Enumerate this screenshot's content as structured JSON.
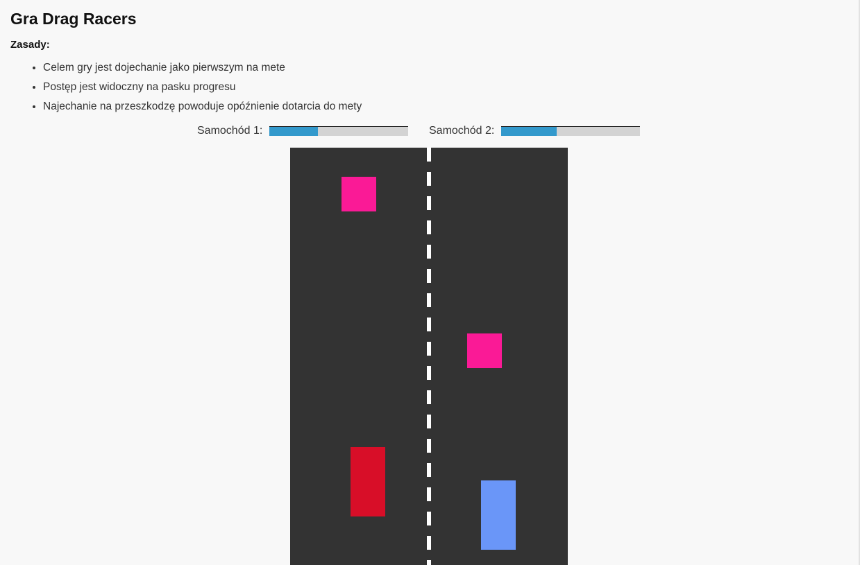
{
  "title": "Gra Drag Racers",
  "rules": {
    "heading": "Zasady:",
    "items": [
      "Celem gry jest dojechanie jako pierwszym na mete",
      "Postęp jest widoczny na pasku progresu",
      "Najechanie na przeszkodzę powoduje opóźnienie dotarcia do mety"
    ]
  },
  "progress": {
    "car1": {
      "label": "Samochód 1:",
      "fraction": 0.35
    },
    "car2": {
      "label": "Samochód 2:",
      "fraction": 0.4
    }
  },
  "colors": {
    "progress_fill": "#3399cc",
    "progress_track": "#d3d3d3",
    "road": "#333333",
    "lane_divider": "#ffffff",
    "obstacle": "#fa1a96",
    "car1": "#d80e28",
    "car2": "#6a96f8"
  }
}
